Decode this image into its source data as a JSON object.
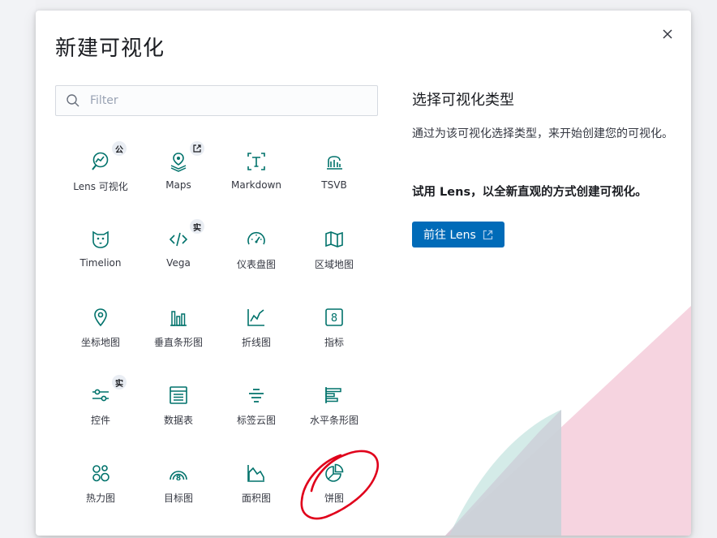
{
  "modal": {
    "title": "新建可视化",
    "close_icon": "close-icon"
  },
  "search": {
    "placeholder": "Filter",
    "value": "",
    "icon": "search-icon"
  },
  "visualizations": [
    {
      "label": "Lens 可视化",
      "icon": "lens-icon",
      "badge": "公"
    },
    {
      "label": "Maps",
      "icon": "maps-icon",
      "badge": "external-link-icon"
    },
    {
      "label": "Markdown",
      "icon": "markdown-icon"
    },
    {
      "label": "TSVB",
      "icon": "tsvb-icon"
    },
    {
      "label": "Timelion",
      "icon": "timelion-icon"
    },
    {
      "label": "Vega",
      "icon": "vega-icon",
      "badge": "实"
    },
    {
      "label": "仪表盘图",
      "icon": "gauge-icon"
    },
    {
      "label": "区域地图",
      "icon": "region-map-icon"
    },
    {
      "label": "坐标地图",
      "icon": "coordinate-map-icon"
    },
    {
      "label": "垂直条形图",
      "icon": "vertical-bar-icon"
    },
    {
      "label": "折线图",
      "icon": "line-chart-icon"
    },
    {
      "label": "指标",
      "icon": "metric-icon"
    },
    {
      "label": "控件",
      "icon": "controls-icon",
      "badge": "实"
    },
    {
      "label": "数据表",
      "icon": "data-table-icon"
    },
    {
      "label": "标签云图",
      "icon": "tag-cloud-icon"
    },
    {
      "label": "水平条形图",
      "icon": "horizontal-bar-icon"
    },
    {
      "label": "热力图",
      "icon": "heatmap-icon"
    },
    {
      "label": "目标图",
      "icon": "goal-icon"
    },
    {
      "label": "面积图",
      "icon": "area-chart-icon"
    },
    {
      "label": "饼图",
      "icon": "pie-chart-icon"
    }
  ],
  "panel": {
    "title": "选择可视化类型",
    "description": "通过为该可视化选择类型，来开始创建您的可视化。",
    "lens_promo": "试用 Lens，以全新直观的方式创建可视化。",
    "lens_button": "前往 Lens",
    "lens_button_icon": "external-link-icon"
  },
  "colors": {
    "icon": "#00726b",
    "button": "#006bb8",
    "annotation": "#e0001b"
  }
}
